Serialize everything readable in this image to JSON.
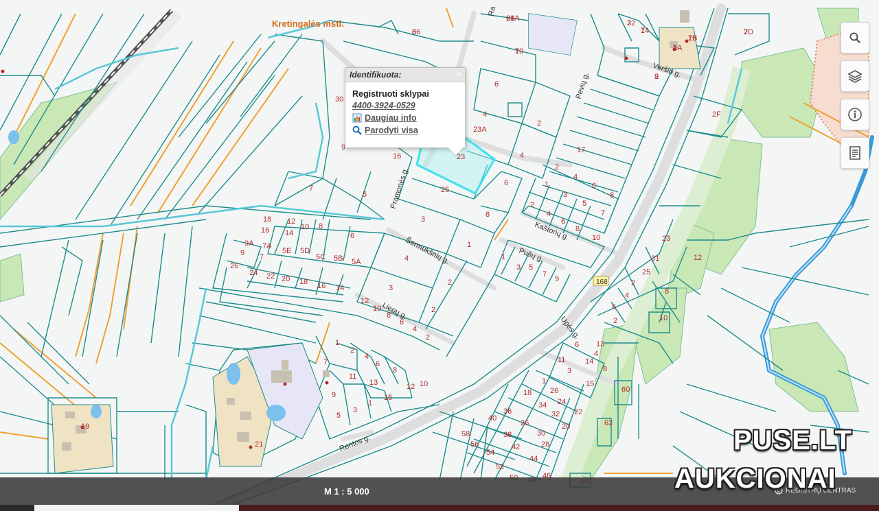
{
  "map": {
    "town_label": "Kretingalės mstl.",
    "street_labels": {
      "pramones": "Pramonės g.",
      "sermuksniu": "Šermukšnių g.",
      "kastonu": "Kaštonų g.",
      "pusu": "Pušų g.",
      "liepu": "Liepų g.",
      "upes": "Upės g.",
      "rentos": "Rentos g.",
      "versio": "Veršio g.",
      "top_street": "Ra",
      "north_street": "Pevių g.",
      "road_number": "168"
    },
    "parcel_numbers": [
      "8",
      "21A",
      "1",
      "3",
      "1",
      "1B",
      "1A",
      "2D",
      "2",
      "6",
      "4",
      "2",
      "23A",
      "2F",
      "30",
      "9",
      "16",
      "23",
      "4",
      "17",
      "25",
      "7",
      "5",
      "3",
      "6",
      "8",
      "2",
      "4",
      "6",
      "8",
      "1",
      "3",
      "5",
      "7",
      "2",
      "4",
      "6",
      "8",
      "10",
      "18",
      "12",
      "10",
      "8",
      "16",
      "14",
      "6",
      "9A",
      "7A",
      "5E",
      "5D",
      "5C",
      "5B",
      "5A",
      "9",
      "7",
      "26",
      "24",
      "22",
      "20",
      "18",
      "16",
      "14",
      "4",
      "1",
      "1",
      "3",
      "5",
      "7",
      "9",
      "2",
      "3",
      "12",
      "10",
      "8",
      "6",
      "4",
      "2",
      "2",
      "1",
      "2",
      "4",
      "6",
      "8",
      "10",
      "12",
      "15",
      "13",
      "11",
      "9",
      "7",
      "5",
      "3",
      "1",
      "19",
      "21",
      "23",
      "31",
      "25",
      "2",
      "4",
      "6",
      "8",
      "10",
      "12",
      "2",
      "6",
      "4",
      "8",
      "14",
      "13",
      "11",
      "3",
      "15",
      "1",
      "26",
      "24",
      "22",
      "20",
      "18",
      "34",
      "32",
      "30",
      "28",
      "26",
      "36",
      "38",
      "40",
      "42",
      "44",
      "46",
      "48",
      "50",
      "52",
      "54",
      "56",
      "58",
      "60",
      "62",
      "64",
      "66",
      "68",
      "70",
      "72",
      "74",
      "76",
      "5",
      "7",
      "9"
    ]
  },
  "popup": {
    "header": "Identifikuota:",
    "close_symbol": "×",
    "title": "Registruoti sklypai",
    "code": "4400-3924-0529",
    "link_more": "Daugiau info",
    "link_show_all": "Parodyti visa"
  },
  "tools": {
    "icons": [
      "search-icon",
      "layers-icon",
      "info-icon",
      "document-icon"
    ]
  },
  "scalebar": {
    "scale": "M 1 : 5 000",
    "registry": "REGISTRŲ CENTRAS"
  },
  "watermark": {
    "line1": "PUSE.LT",
    "line2": "AUKCIONAI"
  },
  "colors": {
    "parcel_line": "#1e8c8c",
    "road_fill": "#e0e0e0",
    "forest": "#c9e8b6",
    "river": "#3a9ad9",
    "highlight": "#3ee0f0",
    "label": "#b22b2b",
    "orange_line": "#f0a030"
  }
}
